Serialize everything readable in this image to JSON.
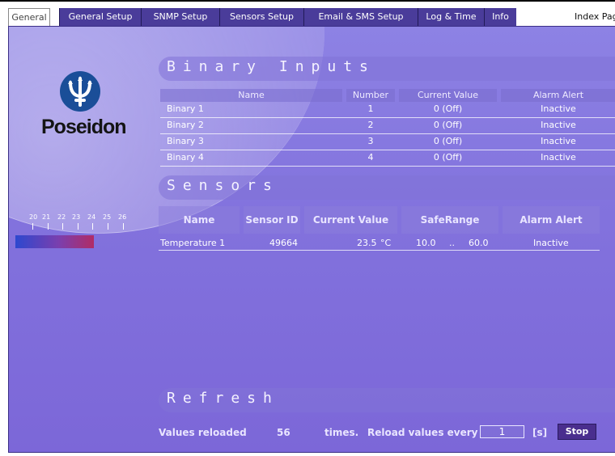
{
  "tabs": [
    {
      "label": "General",
      "active": true
    },
    {
      "label": "General Setup"
    },
    {
      "label": "SNMP Setup"
    },
    {
      "label": "Sensors Setup"
    },
    {
      "label": "Email & SMS Setup"
    },
    {
      "label": "Log & Time"
    },
    {
      "label": "Info"
    }
  ],
  "index_page": "Index Page",
  "logo": {
    "text": "Poseidon",
    "icon": "trident-icon"
  },
  "binary": {
    "title": "Binary Inputs",
    "columns": [
      "Name",
      "Number",
      "Current Value",
      "Alarm Alert"
    ],
    "rows": [
      {
        "name": "Binary 1",
        "number": "1",
        "value": "0 (Off)",
        "alarm": "Inactive"
      },
      {
        "name": "Binary 2",
        "number": "2",
        "value": "0 (Off)",
        "alarm": "Inactive"
      },
      {
        "name": "Binary 3",
        "number": "3",
        "value": "0 (Off)",
        "alarm": "Inactive"
      },
      {
        "name": "Binary 4",
        "number": "4",
        "value": "0 (Off)",
        "alarm": "Inactive"
      }
    ]
  },
  "sensors": {
    "title": "Sensors",
    "columns": [
      "Name",
      "Sensor ID",
      "Current Value",
      "SafeRange",
      "Alarm Alert"
    ],
    "scale_ticks": [
      "20",
      "21",
      "22",
      "23",
      "24",
      "25",
      "26"
    ],
    "rows": [
      {
        "name": "Temperature 1",
        "id": "49664",
        "value": "23.5",
        "unit": "°C",
        "range_low": "10.0",
        "range_sep": "..",
        "range_high": "60.0",
        "alarm": "Inactive"
      }
    ]
  },
  "refresh": {
    "title": "Refresh",
    "reloaded_label": "Values reloaded",
    "count": "56",
    "times_label": "times.",
    "every_label": "Reload values every",
    "interval": "1",
    "unit": "[s]",
    "stop_label": "Stop"
  },
  "colors": {
    "panel": "#8272dd",
    "tab": "#4a3c9a",
    "logo_blue": "#1a4e98",
    "scale_start": "#2d48cf",
    "scale_end": "#b02c66"
  }
}
